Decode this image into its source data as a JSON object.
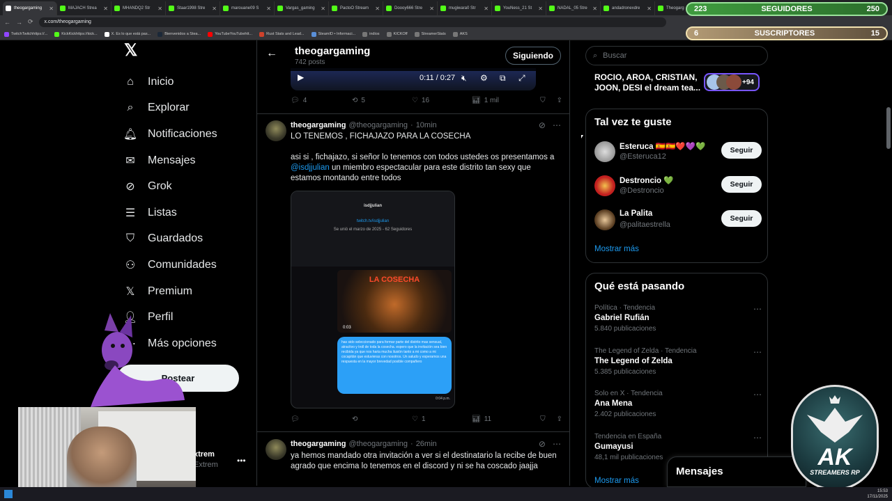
{
  "browser": {
    "tabs": [
      {
        "label": "theogargaming"
      },
      {
        "label": "MAJACH Strea"
      },
      {
        "label": "MHANDQ2 Str"
      },
      {
        "label": "Staar1998 Stre"
      },
      {
        "label": "marouane09 S"
      },
      {
        "label": "Vargas_gaming"
      },
      {
        "label": "PactoO Stream"
      },
      {
        "label": "Doooy666 Stre"
      },
      {
        "label": "mugiwara0 Str"
      },
      {
        "label": "YouNess_21 St"
      },
      {
        "label": "NADAL_05 Stre"
      },
      {
        "label": "andadronexdre"
      },
      {
        "label": "Theogarg"
      }
    ],
    "url": "x.com/theogargaming",
    "bookmarks": [
      "TwitchTwitchhttps://...",
      "KickKickhttps://kick...",
      "X. Es lo que está pas...",
      "Bienvenidos a Stea...",
      "YouTubeYouTubehtt...",
      "Rust Stats and Lead...",
      "SteamID • Informaci...",
      "indios",
      "KICKOff",
      "StreamerStats",
      "AKS"
    ]
  },
  "overlays": {
    "followers": {
      "left": "223",
      "label": "SEGUIDORES",
      "right": "250"
    },
    "subs": {
      "left": "6",
      "label": "SUSCRIPTORES",
      "right": "15"
    }
  },
  "nav": {
    "items": [
      {
        "label": "Inicio",
        "icon": "home-icon"
      },
      {
        "label": "Explorar",
        "icon": "search-icon"
      },
      {
        "label": "Notificaciones",
        "icon": "bell-icon"
      },
      {
        "label": "Mensajes",
        "icon": "mail-icon"
      },
      {
        "label": "Grok",
        "icon": "grok-icon"
      },
      {
        "label": "Listas",
        "icon": "list-icon"
      },
      {
        "label": "Guardados",
        "icon": "bookmark-icon"
      },
      {
        "label": "Comunidades",
        "icon": "communities-icon"
      },
      {
        "label": "Premium",
        "icon": "x-icon"
      },
      {
        "label": "Perfil",
        "icon": "profile-icon"
      },
      {
        "label": "Más opciones",
        "icon": "more-icon"
      }
    ],
    "post_button": "Postear",
    "account_name": "xtrem",
    "account_handle": "Extrem"
  },
  "header": {
    "title": "theogargaming",
    "posts": "742 posts",
    "following_button": "Siguiendo"
  },
  "video": {
    "time": "0:11 / 0:27"
  },
  "first_post_stats": {
    "replies": "4",
    "reposts": "5",
    "likes": "16",
    "views": "1 mil"
  },
  "tweet1": {
    "name": "theogargaming",
    "handle": "@theogargaming",
    "time": "10min",
    "line1": "LO TENEMOS , FICHAJAZO PARA LA COSECHA",
    "line2a": "asi si , fichajazo, si señor lo tenemos con todos ustedes os presentamos a",
    "mention": "@isdjjulian",
    "line2b": " un miembro espectacular para este distrito tan sexy que estamos montando entre todos",
    "stats": {
      "replies": "",
      "reposts": "",
      "likes": "1",
      "views": "11"
    },
    "media": {
      "profile_name": "isdjjulian",
      "profile_link": "twitch.tv/isdjjulian",
      "joined": "Se unió el marzo de 2025 - 62 Seguidores",
      "poster_title": "LA COSECHA",
      "poster_time": "0:03",
      "bubble_text": "has sido seleccionado para formar parte del distrito mas sensual, atractivo y troll de toda la cosecha. espero que la invitación sea bien recibida ya que nos haria mucha ilusión tanto a mi como a mi cocapitán que estuvieras con nosotros. Un saludo y esperamos una respuesta en la mayor brevedad posible compañero",
      "bubble_time": "0:04 p.m."
    }
  },
  "tweet2": {
    "name": "theogargaming",
    "handle": "@theogargaming",
    "time": "26min",
    "text": "ya hemos mandado otra invitación a ver si el destinatario la recibe de buen agrado que encima lo tenemos en el discord y ni se ha coscado jaajja"
  },
  "sidebar": {
    "search_placeholder": "Buscar",
    "community_text": "ROCIO, AROA, CRISTIAN, JOON, DESI el dream tea...",
    "community_count": "+94",
    "who_title": "Tal vez te guste",
    "who": [
      {
        "name": "Esteruca 🇪🇸🇪🇸❤️💜💚",
        "handle": "@Esteruca12",
        "button": "Seguir"
      },
      {
        "name": "Destroncio 💚",
        "handle": "@Destroncio",
        "button": "Seguir"
      },
      {
        "name": "La Palita",
        "handle": "@palitaestrella",
        "button": "Seguir"
      }
    ],
    "show_more": "Mostrar más",
    "trends_title": "Qué está pasando",
    "trends": [
      {
        "context": "Política · Tendencia",
        "title": "Gabriel Rufián",
        "count": "5.840 publicaciones"
      },
      {
        "context": "The Legend of Zelda · Tendencia",
        "title": "The Legend of Zelda",
        "count": "5.385 publicaciones"
      },
      {
        "context": "Solo en X · Tendencia",
        "title": "Ana Mena",
        "count": "2.402 publicaciones"
      },
      {
        "context": "Tendencia en España",
        "title": "Gumayusi",
        "count": "48,1 mil publicaciones"
      }
    ],
    "trends_more": "Mostrar más"
  },
  "messages_dock": "Mensajes",
  "stream_logo": {
    "big": "AK",
    "small": "STREAMERS RP"
  },
  "taskbar": {
    "time": "15:53",
    "date": "17/11/2025"
  }
}
